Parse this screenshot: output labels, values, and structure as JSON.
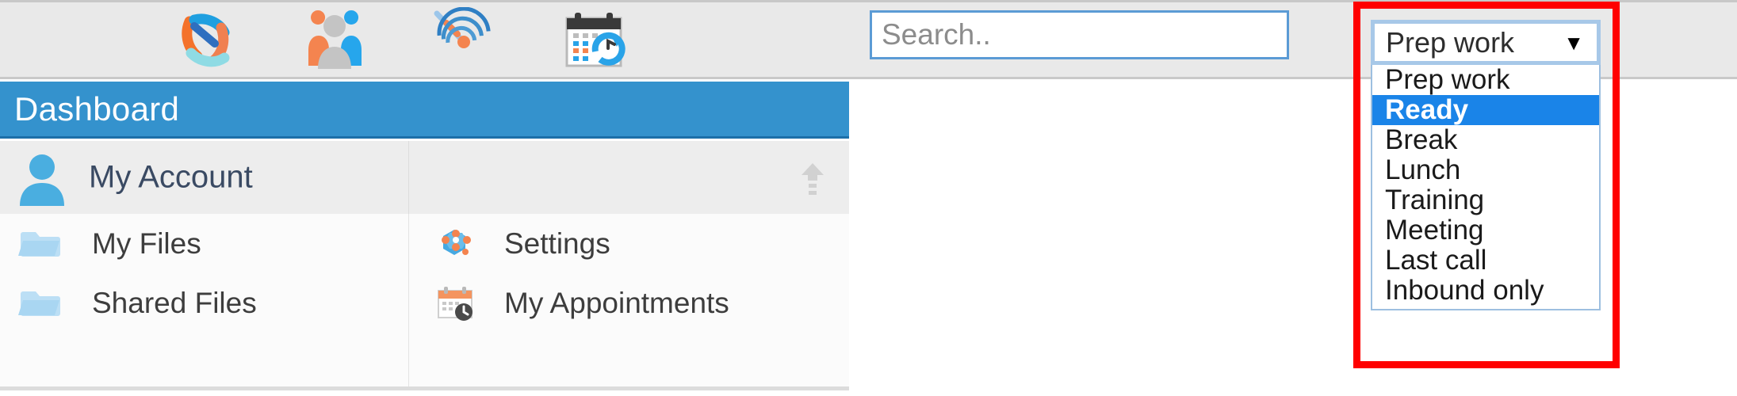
{
  "toolbar": {
    "icons": [
      {
        "name": "crm-logo-icon",
        "title": "Home"
      },
      {
        "name": "contacts-icon",
        "title": "Contacts"
      },
      {
        "name": "campaign-target-icon",
        "title": "Campaigns"
      },
      {
        "name": "calendar-refresh-icon",
        "title": "Schedule"
      }
    ]
  },
  "search": {
    "placeholder": "Search..",
    "value": ""
  },
  "status": {
    "selected": "Prep work",
    "caret": "▼",
    "highlight_color": "#ff0000",
    "selected_option_index": 1,
    "options": [
      "Prep work",
      "Ready",
      "Break",
      "Lunch",
      "Training",
      "Meeting",
      "Last call",
      "Inbound only"
    ]
  },
  "dashboard": {
    "title": "Dashboard",
    "header_color": "#3492cd",
    "account": {
      "label": "My Account",
      "collapse_icon": "arrow-up-icon"
    },
    "menu_left": [
      {
        "icon": "folder-icon",
        "label": "My Files"
      },
      {
        "icon": "folder-shared-icon",
        "label": "Shared Files"
      }
    ],
    "menu_right": [
      {
        "icon": "settings-gear-icon",
        "label": "Settings"
      },
      {
        "icon": "calendar-clock-icon",
        "label": "My Appointments"
      }
    ]
  }
}
